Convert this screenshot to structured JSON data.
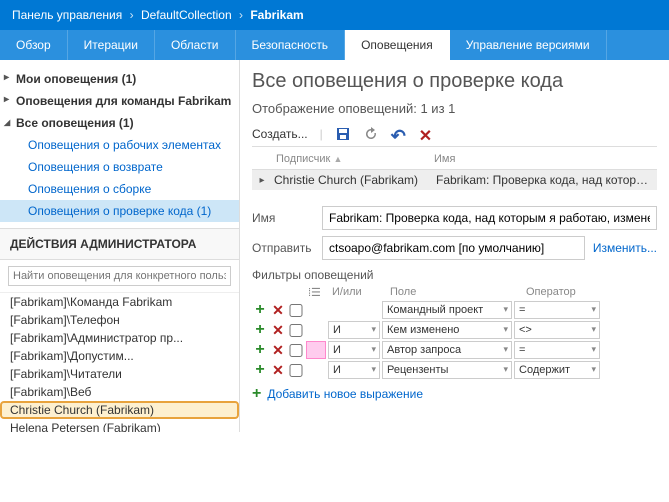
{
  "breadcrumb": {
    "items": [
      "Панель управления",
      "DefaultCollection",
      "Fabrikam"
    ]
  },
  "tabs": {
    "items": [
      "Обзор",
      "Итерации",
      "Области",
      "Безопасность",
      "Оповещения",
      "Управление версиями"
    ],
    "active": 4
  },
  "sidebar": {
    "tree": [
      {
        "label": "Мои оповещения (1)",
        "expanded": false
      },
      {
        "label": "Оповещения для команды Fabrikam",
        "expanded": false
      },
      {
        "label": "Все оповещения (1)",
        "expanded": true,
        "children": [
          "Оповещения о рабочих элементах",
          "Оповещения о возврате",
          "Оповещения о сборке",
          "Оповещения о проверке кода (1)"
        ],
        "selected_child": 3
      }
    ],
    "admin_header": "ДЕЙСТВИЯ АДМИНИСТРАТОРА",
    "search_placeholder": "Найти оповещения для конкретного пользователя",
    "users": [
      "[Fabrikam]\\Команда Fabrikam",
      "[Fabrikam]\\Телефон",
      "[Fabrikam]\\Администратор пр...",
      "[Fabrikam]\\Допустим...",
      "[Fabrikam]\\Читатели",
      "[Fabrikam]\\Веб",
      "Christie Church (Fabrikam)",
      "Helena Petersen (Fabrikam)"
    ],
    "highlighted_user": 6
  },
  "content": {
    "title": "Все оповещения о проверке кода",
    "display_count": "Отображение оповещений: 1 из 1",
    "toolbar": {
      "create": "Создать..."
    },
    "grid": {
      "headers": {
        "subscriber": "Подписчик",
        "name": "Имя"
      },
      "rows": [
        {
          "subscriber": "Christie Church (Fabrikam)",
          "name": "Fabrikam: Проверка кода, над которым я рабо..."
        }
      ]
    },
    "form": {
      "name_label": "Имя",
      "name_value": "Fabrikam: Проверка кода, над которым я работаю, изменена [си...",
      "send_label": "Отправить",
      "send_value": "ctsoapo@fabrikam.com [по умолчанию]",
      "change_link": "Изменить..."
    },
    "filters": {
      "title": "Фильтры оповещений",
      "headers": {
        "andor": "И/или",
        "field": "Поле",
        "op": "Оператор"
      },
      "rows": [
        {
          "group": false,
          "andor": "",
          "field": "Командный проект",
          "op": "="
        },
        {
          "group": false,
          "andor": "И",
          "field": "Кем изменено",
          "op": "<>"
        },
        {
          "group": true,
          "andor": "И",
          "field": "Автор запроса",
          "op": "="
        },
        {
          "group": false,
          "andor": "И",
          "field": "Рецензенты",
          "op": "Содержит"
        }
      ],
      "add_expr": "Добавить новое выражение"
    }
  }
}
